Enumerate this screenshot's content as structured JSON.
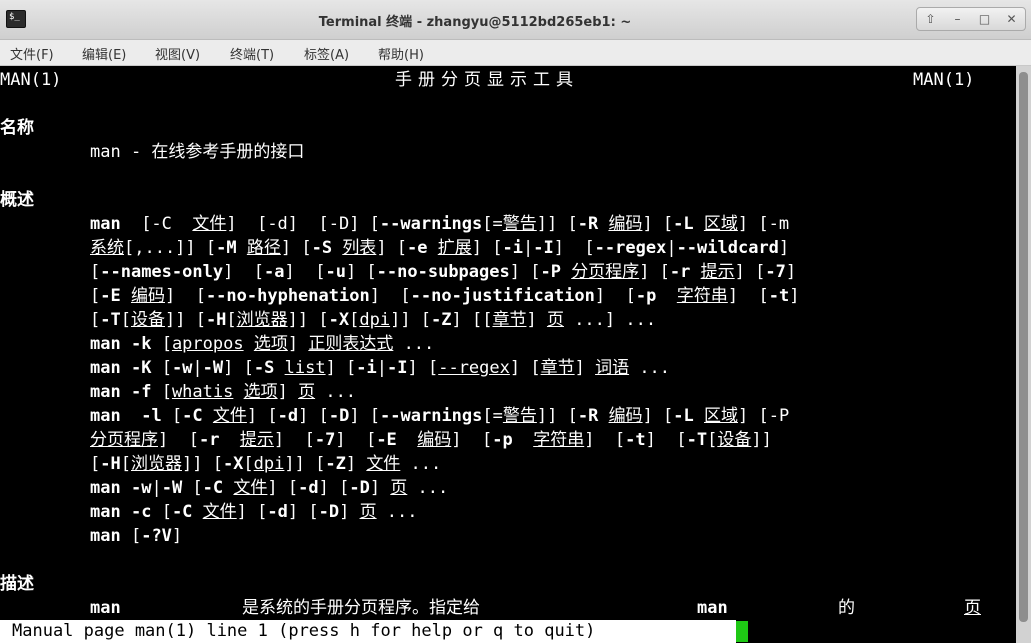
{
  "window": {
    "title": "Terminal 终端 - zhangyu@5112bd265eb1: ~",
    "icon_text": "$_",
    "buttons": [
      "⇧",
      "–",
      "□",
      "✕"
    ]
  },
  "menu": [
    {
      "label": "文件(F)"
    },
    {
      "label": "编辑(E)"
    },
    {
      "label": "视图(V)"
    },
    {
      "label": "终端(T)"
    },
    {
      "label": "标签(A)"
    },
    {
      "label": "帮助(H)"
    }
  ],
  "man": {
    "header_left": "MAN(1)",
    "header_center": "手册分页显示工具",
    "header_right": "MAN(1)",
    "section_name": "名称",
    "name_line": "man - 在线参考手册的接口",
    "section_synopsis": "概述",
    "section_description": "描述",
    "synopsis": [
      [
        {
          "t": "man",
          "s": "b"
        },
        {
          "t": "  [-C  "
        },
        {
          "t": "文件",
          "s": "u"
        },
        {
          "t": "]  [-d]  [-D] ["
        },
        {
          "t": "--warnings",
          "s": "b"
        },
        {
          "t": "[="
        },
        {
          "t": "警告",
          "s": "u"
        },
        {
          "t": "]] ["
        },
        {
          "t": "-R",
          "s": "b"
        },
        {
          "t": " "
        },
        {
          "t": "编码",
          "s": "u"
        },
        {
          "t": "] ["
        },
        {
          "t": "-L",
          "s": "b"
        },
        {
          "t": " "
        },
        {
          "t": "区域",
          "s": "u"
        },
        {
          "t": "] [-m"
        }
      ],
      [
        {
          "t": "系统",
          "s": "u"
        },
        {
          "t": "[,...]] ["
        },
        {
          "t": "-M",
          "s": "b"
        },
        {
          "t": " "
        },
        {
          "t": "路径",
          "s": "u"
        },
        {
          "t": "] ["
        },
        {
          "t": "-S",
          "s": "b"
        },
        {
          "t": " "
        },
        {
          "t": "列表",
          "s": "u"
        },
        {
          "t": "] ["
        },
        {
          "t": "-e",
          "s": "b"
        },
        {
          "t": " "
        },
        {
          "t": "扩展",
          "s": "u"
        },
        {
          "t": "] ["
        },
        {
          "t": "-i",
          "s": "b"
        },
        {
          "t": "|"
        },
        {
          "t": "-I",
          "s": "b"
        },
        {
          "t": "]  ["
        },
        {
          "t": "--regex",
          "s": "b"
        },
        {
          "t": "|"
        },
        {
          "t": "--wildcard",
          "s": "b"
        },
        {
          "t": "]"
        }
      ],
      [
        {
          "t": "["
        },
        {
          "t": "--names-only",
          "s": "b"
        },
        {
          "t": "]  ["
        },
        {
          "t": "-a",
          "s": "b"
        },
        {
          "t": "]  ["
        },
        {
          "t": "-u",
          "s": "b"
        },
        {
          "t": "] ["
        },
        {
          "t": "--no-subpages",
          "s": "b"
        },
        {
          "t": "] ["
        },
        {
          "t": "-P",
          "s": "b"
        },
        {
          "t": " "
        },
        {
          "t": "分页程序",
          "s": "u"
        },
        {
          "t": "] ["
        },
        {
          "t": "-r",
          "s": "b"
        },
        {
          "t": " "
        },
        {
          "t": "提示",
          "s": "u"
        },
        {
          "t": "] ["
        },
        {
          "t": "-7",
          "s": "b"
        },
        {
          "t": "]"
        }
      ],
      [
        {
          "t": "["
        },
        {
          "t": "-E",
          "s": "b"
        },
        {
          "t": " "
        },
        {
          "t": "编码",
          "s": "u"
        },
        {
          "t": "]  ["
        },
        {
          "t": "--no-hyphenation",
          "s": "b"
        },
        {
          "t": "]  ["
        },
        {
          "t": "--no-justification",
          "s": "b"
        },
        {
          "t": "]  ["
        },
        {
          "t": "-p",
          "s": "b"
        },
        {
          "t": "  "
        },
        {
          "t": "字符串",
          "s": "u"
        },
        {
          "t": "]  ["
        },
        {
          "t": "-t",
          "s": "b"
        },
        {
          "t": "]"
        }
      ],
      [
        {
          "t": "["
        },
        {
          "t": "-T",
          "s": "b"
        },
        {
          "t": "["
        },
        {
          "t": "设备",
          "s": "u"
        },
        {
          "t": "]] ["
        },
        {
          "t": "-H",
          "s": "b"
        },
        {
          "t": "["
        },
        {
          "t": "浏览器",
          "s": "u"
        },
        {
          "t": "]] ["
        },
        {
          "t": "-X",
          "s": "b"
        },
        {
          "t": "["
        },
        {
          "t": "dpi",
          "s": "u"
        },
        {
          "t": "]] ["
        },
        {
          "t": "-Z",
          "s": "b"
        },
        {
          "t": "] [["
        },
        {
          "t": "章节",
          "s": "u"
        },
        {
          "t": "] "
        },
        {
          "t": "页",
          "s": "u"
        },
        {
          "t": " ...] ..."
        }
      ],
      [
        {
          "t": "man",
          "s": "b"
        },
        {
          "t": " "
        },
        {
          "t": "-k",
          "s": "b"
        },
        {
          "t": " ["
        },
        {
          "t": "apropos",
          "s": "u"
        },
        {
          "t": " "
        },
        {
          "t": "选项",
          "s": "u"
        },
        {
          "t": "] "
        },
        {
          "t": "正则表达式",
          "s": "u"
        },
        {
          "t": " ..."
        }
      ],
      [
        {
          "t": "man",
          "s": "b"
        },
        {
          "t": " "
        },
        {
          "t": "-K",
          "s": "b"
        },
        {
          "t": " ["
        },
        {
          "t": "-w",
          "s": "b"
        },
        {
          "t": "|"
        },
        {
          "t": "-W",
          "s": "b"
        },
        {
          "t": "] ["
        },
        {
          "t": "-S",
          "s": "b"
        },
        {
          "t": " "
        },
        {
          "t": "list",
          "s": "u"
        },
        {
          "t": "] ["
        },
        {
          "t": "-i",
          "s": "b"
        },
        {
          "t": "|"
        },
        {
          "t": "-I",
          "s": "b"
        },
        {
          "t": "] ["
        },
        {
          "t": "--regex",
          "s": "u"
        },
        {
          "t": "] ["
        },
        {
          "t": "章节",
          "s": "u"
        },
        {
          "t": "] "
        },
        {
          "t": "词语",
          "s": "u"
        },
        {
          "t": " ..."
        }
      ],
      [
        {
          "t": "man",
          "s": "b"
        },
        {
          "t": " "
        },
        {
          "t": "-f",
          "s": "b"
        },
        {
          "t": " ["
        },
        {
          "t": "whatis",
          "s": "u"
        },
        {
          "t": " "
        },
        {
          "t": "选项",
          "s": "u"
        },
        {
          "t": "] "
        },
        {
          "t": "页",
          "s": "u"
        },
        {
          "t": " ..."
        }
      ],
      [
        {
          "t": "man",
          "s": "b"
        },
        {
          "t": "  "
        },
        {
          "t": "-l",
          "s": "b"
        },
        {
          "t": " ["
        },
        {
          "t": "-C",
          "s": "b"
        },
        {
          "t": " "
        },
        {
          "t": "文件",
          "s": "u"
        },
        {
          "t": "] ["
        },
        {
          "t": "-d",
          "s": "b"
        },
        {
          "t": "] ["
        },
        {
          "t": "-D",
          "s": "b"
        },
        {
          "t": "] ["
        },
        {
          "t": "--warnings",
          "s": "b"
        },
        {
          "t": "[="
        },
        {
          "t": "警告",
          "s": "u"
        },
        {
          "t": "]] ["
        },
        {
          "t": "-R",
          "s": "b"
        },
        {
          "t": " "
        },
        {
          "t": "编码",
          "s": "u"
        },
        {
          "t": "] ["
        },
        {
          "t": "-L",
          "s": "b"
        },
        {
          "t": " "
        },
        {
          "t": "区域",
          "s": "u"
        },
        {
          "t": "] [-P"
        }
      ],
      [
        {
          "t": "分页程序",
          "s": "u"
        },
        {
          "t": "]  ["
        },
        {
          "t": "-r",
          "s": "b"
        },
        {
          "t": "  "
        },
        {
          "t": "提示",
          "s": "u"
        },
        {
          "t": "]  ["
        },
        {
          "t": "-7",
          "s": "b"
        },
        {
          "t": "]  ["
        },
        {
          "t": "-E",
          "s": "b"
        },
        {
          "t": "  "
        },
        {
          "t": "编码",
          "s": "u"
        },
        {
          "t": "]  ["
        },
        {
          "t": "-p",
          "s": "b"
        },
        {
          "t": "  "
        },
        {
          "t": "字符串",
          "s": "u"
        },
        {
          "t": "]  ["
        },
        {
          "t": "-t",
          "s": "b"
        },
        {
          "t": "]  ["
        },
        {
          "t": "-T",
          "s": "b"
        },
        {
          "t": "["
        },
        {
          "t": "设备",
          "s": "u"
        },
        {
          "t": "]]"
        }
      ],
      [
        {
          "t": "["
        },
        {
          "t": "-H",
          "s": "b"
        },
        {
          "t": "["
        },
        {
          "t": "浏览器",
          "s": "u"
        },
        {
          "t": "]] ["
        },
        {
          "t": "-X",
          "s": "b"
        },
        {
          "t": "["
        },
        {
          "t": "dpi",
          "s": "u"
        },
        {
          "t": "]] ["
        },
        {
          "t": "-Z",
          "s": "b"
        },
        {
          "t": "] "
        },
        {
          "t": "文件",
          "s": "u"
        },
        {
          "t": " ..."
        }
      ],
      [
        {
          "t": "man",
          "s": "b"
        },
        {
          "t": " "
        },
        {
          "t": "-w",
          "s": "b"
        },
        {
          "t": "|"
        },
        {
          "t": "-W",
          "s": "b"
        },
        {
          "t": " ["
        },
        {
          "t": "-C",
          "s": "b"
        },
        {
          "t": " "
        },
        {
          "t": "文件",
          "s": "u"
        },
        {
          "t": "] ["
        },
        {
          "t": "-d",
          "s": "b"
        },
        {
          "t": "] ["
        },
        {
          "t": "-D",
          "s": "b"
        },
        {
          "t": "] "
        },
        {
          "t": "页",
          "s": "u"
        },
        {
          "t": " ..."
        }
      ],
      [
        {
          "t": "man",
          "s": "b"
        },
        {
          "t": " "
        },
        {
          "t": "-c",
          "s": "b"
        },
        {
          "t": " ["
        },
        {
          "t": "-C",
          "s": "b"
        },
        {
          "t": " "
        },
        {
          "t": "文件",
          "s": "u"
        },
        {
          "t": "] ["
        },
        {
          "t": "-d",
          "s": "b"
        },
        {
          "t": "] ["
        },
        {
          "t": "-D",
          "s": "b"
        },
        {
          "t": "] "
        },
        {
          "t": "页",
          "s": "u"
        },
        {
          "t": " ..."
        }
      ],
      [
        {
          "t": "man",
          "s": "b"
        },
        {
          "t": " ["
        },
        {
          "t": "-?V",
          "s": "b"
        },
        {
          "t": "]"
        }
      ]
    ],
    "description_words": {
      "w1": "man",
      "w2": "是系统的手册分页程序。指定给",
      "w3": "man",
      "w4": "的",
      "w5": "页"
    }
  },
  "status": {
    "text": "Manual page man(1) line 1 (press h for help or q to quit)"
  },
  "colors": {
    "cursor": "#1ec814",
    "background": "#000000",
    "foreground": "#ffffff"
  }
}
